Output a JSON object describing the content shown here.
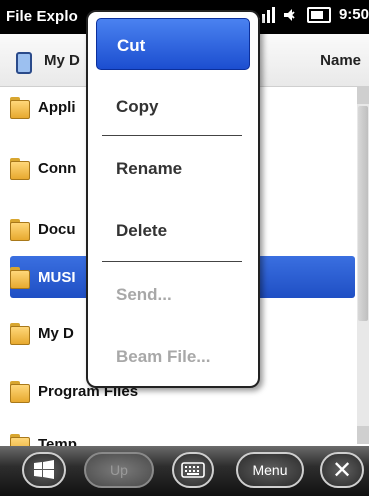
{
  "statusbar": {
    "title": "File Explo",
    "time": "9:50",
    "icons": [
      "signal-icon",
      "volume-icon",
      "battery-icon"
    ]
  },
  "header": {
    "folder": "My D",
    "sort": "Name"
  },
  "list": {
    "items": [
      {
        "label": "Appli",
        "selected": false
      },
      {
        "label": "Conn",
        "selected": false
      },
      {
        "label": "Docu",
        "selected": false
      },
      {
        "label": "MUSI",
        "selected": true
      },
      {
        "label": "My D",
        "selected": false
      },
      {
        "label": "Program Files",
        "selected": false
      },
      {
        "label": "Temp",
        "selected": false
      }
    ]
  },
  "context_menu": {
    "items": [
      {
        "label": "Cut",
        "state": "active"
      },
      {
        "label": "Copy",
        "state": "enabled"
      },
      {
        "label": "Rename",
        "state": "enabled"
      },
      {
        "label": "Delete",
        "state": "enabled"
      },
      {
        "label": "Send...",
        "state": "disabled"
      },
      {
        "label": "Beam File...",
        "state": "disabled"
      }
    ]
  },
  "bottombar": {
    "up_label": "Up",
    "menu_label": "Menu",
    "close_label": "✕",
    "icons": [
      "windows-start-icon",
      "keyboard-icon",
      "close-icon"
    ]
  },
  "colors": {
    "selection": "#2a5bd8",
    "statusbar": "#000000",
    "menu_border": "#222222"
  }
}
